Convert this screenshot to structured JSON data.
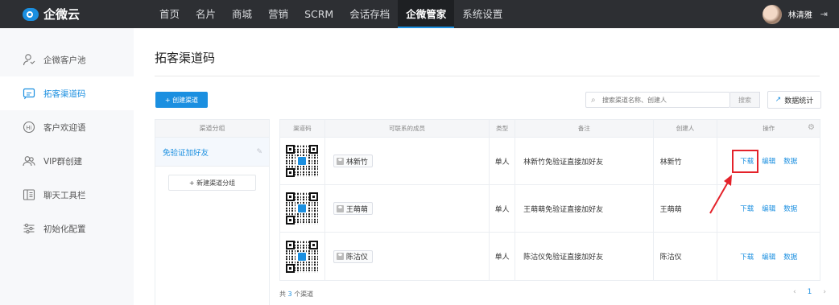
{
  "brand": {
    "name": "企微云"
  },
  "nav": {
    "items": [
      {
        "label": "首页"
      },
      {
        "label": "名片"
      },
      {
        "label": "商城"
      },
      {
        "label": "营销"
      },
      {
        "label": "SCRM"
      },
      {
        "label": "会话存档"
      },
      {
        "label": "企微管家",
        "active": true
      },
      {
        "label": "系统设置"
      }
    ]
  },
  "user": {
    "name": "林清雅",
    "logout_icon": "logout-icon"
  },
  "sidebar": {
    "items": [
      {
        "label": "企微客户池",
        "icon": "user-icon"
      },
      {
        "label": "拓客渠道码",
        "icon": "message-icon",
        "active": true
      },
      {
        "label": "客户欢迎语",
        "icon": "hi-bubble-icon"
      },
      {
        "label": "VIP群创建",
        "icon": "group-icon"
      },
      {
        "label": "聊天工具栏",
        "icon": "toolbar-icon"
      },
      {
        "label": "初始化配置",
        "icon": "sliders-icon"
      }
    ]
  },
  "page": {
    "title": "拓客渠道码",
    "create_button": "+ 创建渠道",
    "search_placeholder": "搜索渠道名称、创建人",
    "search_button": "搜索",
    "stats_button": "数据统计"
  },
  "groups": {
    "header": "渠道分组",
    "items": [
      {
        "name": "免验证加好友"
      }
    ],
    "new_group_button": "+ 新建渠道分组"
  },
  "table": {
    "headers": [
      "渠道码",
      "可联系的成员",
      "类型",
      "备注",
      "创建人",
      "操作"
    ],
    "rows": [
      {
        "member": "林新竹",
        "type": "单人",
        "note": "林新竹免验证直接加好友",
        "creator": "林新竹",
        "actions": [
          "下载",
          "编辑",
          "数据"
        ]
      },
      {
        "member": "王萌萌",
        "type": "单人",
        "note": "王萌萌免验证直接加好友",
        "creator": "王萌萌",
        "actions": [
          "下载",
          "编辑",
          "数据"
        ]
      },
      {
        "member": "陈沽仪",
        "type": "单人",
        "note": "陈沽仪免验证直接加好友",
        "creator": "陈沽仪",
        "actions": [
          "下载",
          "编辑",
          "数据"
        ]
      }
    ]
  },
  "footer": {
    "total_prefix": "共",
    "total_count": "3",
    "total_suffix": "个渠道",
    "current_page": "1",
    "prev": "‹",
    "next": "›"
  },
  "colors": {
    "accent": "#1b8fe0",
    "highlight": "#e4222a",
    "topbar": "#2d2f33"
  }
}
